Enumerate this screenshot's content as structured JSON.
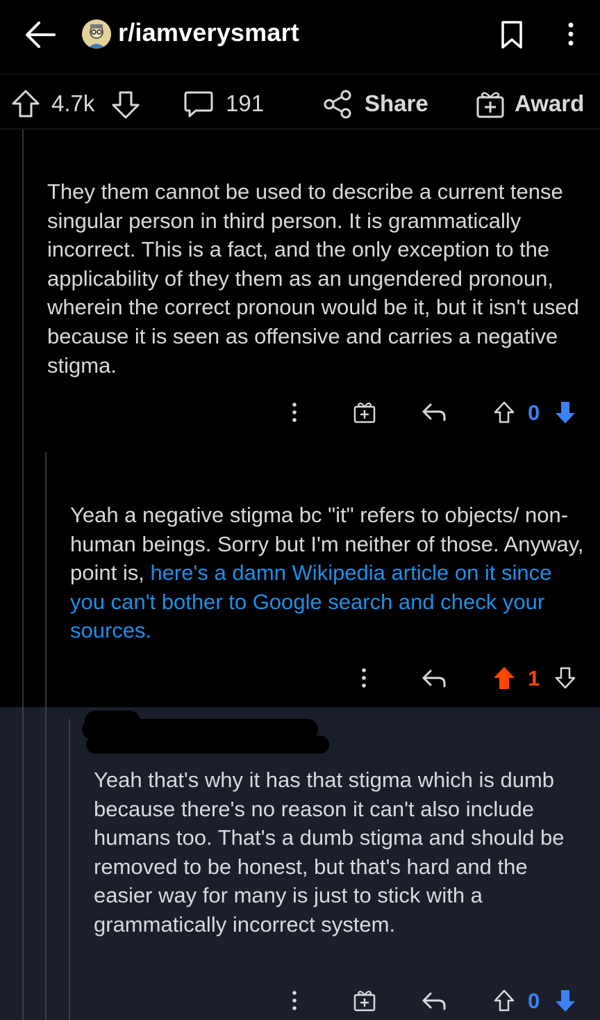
{
  "header": {
    "subreddit": "r/iamverysmart",
    "icons": [
      "back-arrow-icon",
      "subreddit-avatar-icon",
      "bookmark-icon",
      "more-vert-icon"
    ]
  },
  "post_actions": {
    "upvotes": "4.7k",
    "comments": "191",
    "share": "Share",
    "award": "Award"
  },
  "comments": [
    {
      "text": "They them cannot be used to describe a current tense singular person in third person. It is grammatically incorrect. This is a fact, and the only exception to the applicability of they them as an ungendered pronoun, wherein the correct pronoun would be it, but it isn't used because it is seen as offensive and carries a negative stigma.",
      "score": "0",
      "vote_state": "downvoted"
    },
    {
      "text_plain": "Yeah a negative stigma bc \"it\" refers to objects/ non-human beings. Sorry but I'm neither of those. Anyway, point is, ",
      "text_link": "here's a damn Wikipedia article on it since you can't bother to Google search and check your sources.",
      "score": "1",
      "vote_state": "upvoted"
    },
    {
      "text": "Yeah that's why it has that stigma which is dumb because there's no reason it can't also include humans too. That's a dumb stigma and should be removed to be honest, but that's hard and the easier way for many is just to stick with a grammatically incorrect system.",
      "score": "0",
      "vote_state": "downvoted"
    }
  ],
  "colors": {
    "upvote": "#ff4500",
    "downvote": "#3b82f6",
    "link": "#1f8fe8",
    "highlight_bg": "#1a1f2b"
  }
}
